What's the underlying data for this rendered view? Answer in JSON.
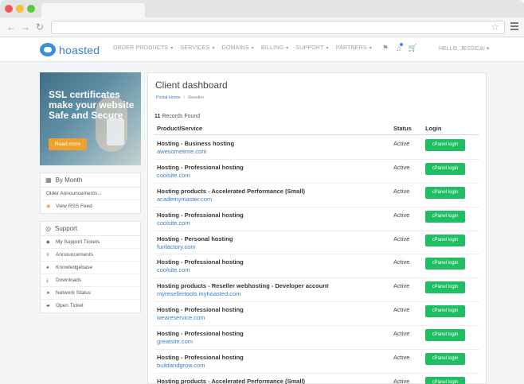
{
  "header": {
    "logo_text": "hoasted",
    "nav": [
      {
        "label": "ORDER PRODUCTS"
      },
      {
        "label": "SERVICES"
      },
      {
        "label": "DOMAINS"
      },
      {
        "label": "BILLING"
      },
      {
        "label": "SUPPORT"
      },
      {
        "label": "PARTNERS"
      }
    ],
    "greeting": "HELLO, JESSICA!"
  },
  "promo": {
    "title": "SSL certificates make your website Safe and Secure",
    "button": "Read more"
  },
  "by_month": {
    "title": "By Month",
    "items": [
      "Older Announcements...",
      "View RSS Feed"
    ]
  },
  "support": {
    "title": "Support",
    "items": [
      "My Support Tickets",
      "Announcements",
      "Knowledgebase",
      "Downloads",
      "Network Status",
      "Open Ticket"
    ]
  },
  "main": {
    "title": "Client dashboard",
    "breadcrumb": {
      "home": "Portal Home",
      "current": "Reseller"
    },
    "records_count": "11",
    "records_label": "Records Found",
    "columns": {
      "product": "Product/Service",
      "status": "Status",
      "login": "Login"
    },
    "rows": [
      {
        "product": "Hosting - Business hosting",
        "domain": "awesometime.com",
        "status": "Active",
        "login": "cPanel login"
      },
      {
        "product": "Hosting - Professional hosting",
        "domain": "coolsite.com",
        "status": "Active",
        "login": "cPanel login"
      },
      {
        "product": "Hosting products - Accelerated Performance (Small)",
        "domain": "academymaster.com",
        "status": "Active",
        "login": "cPanel login"
      },
      {
        "product": "Hosting - Professional hosting",
        "domain": "coolsite.com",
        "status": "Active",
        "login": "cPanel login"
      },
      {
        "product": "Hosting - Personal hosting",
        "domain": "funfactory.com",
        "status": "Active",
        "login": "cPanel login"
      },
      {
        "product": "Hosting - Professional hosting",
        "domain": "coolsite.com",
        "status": "Active",
        "login": "cPanel login"
      },
      {
        "product": "Hosting products - Reseller webhosting - Developer account",
        "domain": "myresellertools.myhoasted.com",
        "status": "Active",
        "login": "cPanel login"
      },
      {
        "product": "Hosting - Professional hosting",
        "domain": "weareservice.com",
        "status": "Active",
        "login": "cPanel login"
      },
      {
        "product": "Hosting - Professional hosting",
        "domain": "greatsite.com",
        "status": "Active",
        "login": "cPanel login"
      },
      {
        "product": "Hosting - Professional hosting",
        "domain": "buildandgrow.com",
        "status": "Active",
        "login": "cPanel login"
      },
      {
        "product": "Hosting products - Accelerated Performance (Small)",
        "domain": "",
        "status": "Active",
        "login": "cPanel login"
      }
    ]
  }
}
